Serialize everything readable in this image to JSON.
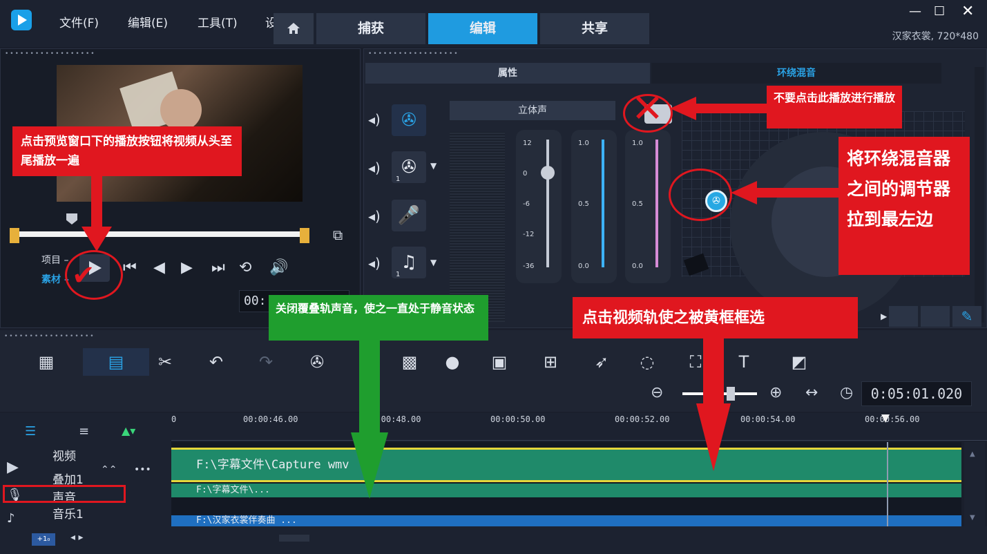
{
  "menu": {
    "file": "文件(F)",
    "edit": "编辑(E)",
    "tools": "工具(T)",
    "settings_partial": "设"
  },
  "tabs": {
    "capture": "捕获",
    "edit": "编辑",
    "share": "共享"
  },
  "window": {
    "project_info": "汉家衣裳, 720*480"
  },
  "preview": {
    "project_label": "项目",
    "clip_label": "素材",
    "timecode_partial": "00:"
  },
  "mixer": {
    "tab_properties": "属性",
    "tab_surround": "环绕混音",
    "stereo_label": "立体声",
    "volume_scale": [
      "12",
      "0",
      "-6",
      "-12",
      "-36"
    ],
    "balance_scale": [
      "1.0",
      "0.5",
      "0.0"
    ],
    "balance_scale2": [
      "1.0",
      "0.5",
      "0.0"
    ],
    "track_badge_1": "1",
    "track_badge_2": "1"
  },
  "timeline": {
    "timecode": "0:05:01.020",
    "ruler": [
      "0",
      "00:00:46.00",
      "00:00:48.00",
      "00:00:50.00",
      "00:00:52.00",
      "00:00:54.00",
      "00:00:56.00"
    ],
    "tracks": {
      "video": "视频",
      "overlay": "叠加1",
      "voice": "声音",
      "music": "音乐1"
    },
    "clips": {
      "video_clip": "F:\\字幕文件\\Capture    wmv",
      "overlay_clip": "F:\\字幕文件\\...",
      "music_clip": "F:\\汉家衣裳伴奏曲  ..."
    },
    "bottom_badge": "+1₀"
  },
  "annotations": {
    "play_hint": "点击预览窗口下的播放按钮将视频从头至尾播放一遍",
    "dont_click": "不要点击此播放进行播放",
    "drag_left": "将环绕混音器之间的调节器拉到最左边",
    "mute_overlay": "关闭覆叠轨声音，使之一直处于静音状态",
    "select_video": "点击视频轨使之被黄框框选"
  },
  "colors": {
    "accent": "#1f9be0",
    "annotation_red": "#e0171f",
    "annotation_green": "#1f9e2e",
    "clip_green": "#1f8a6a",
    "clip_blue": "#1f6fc0"
  }
}
